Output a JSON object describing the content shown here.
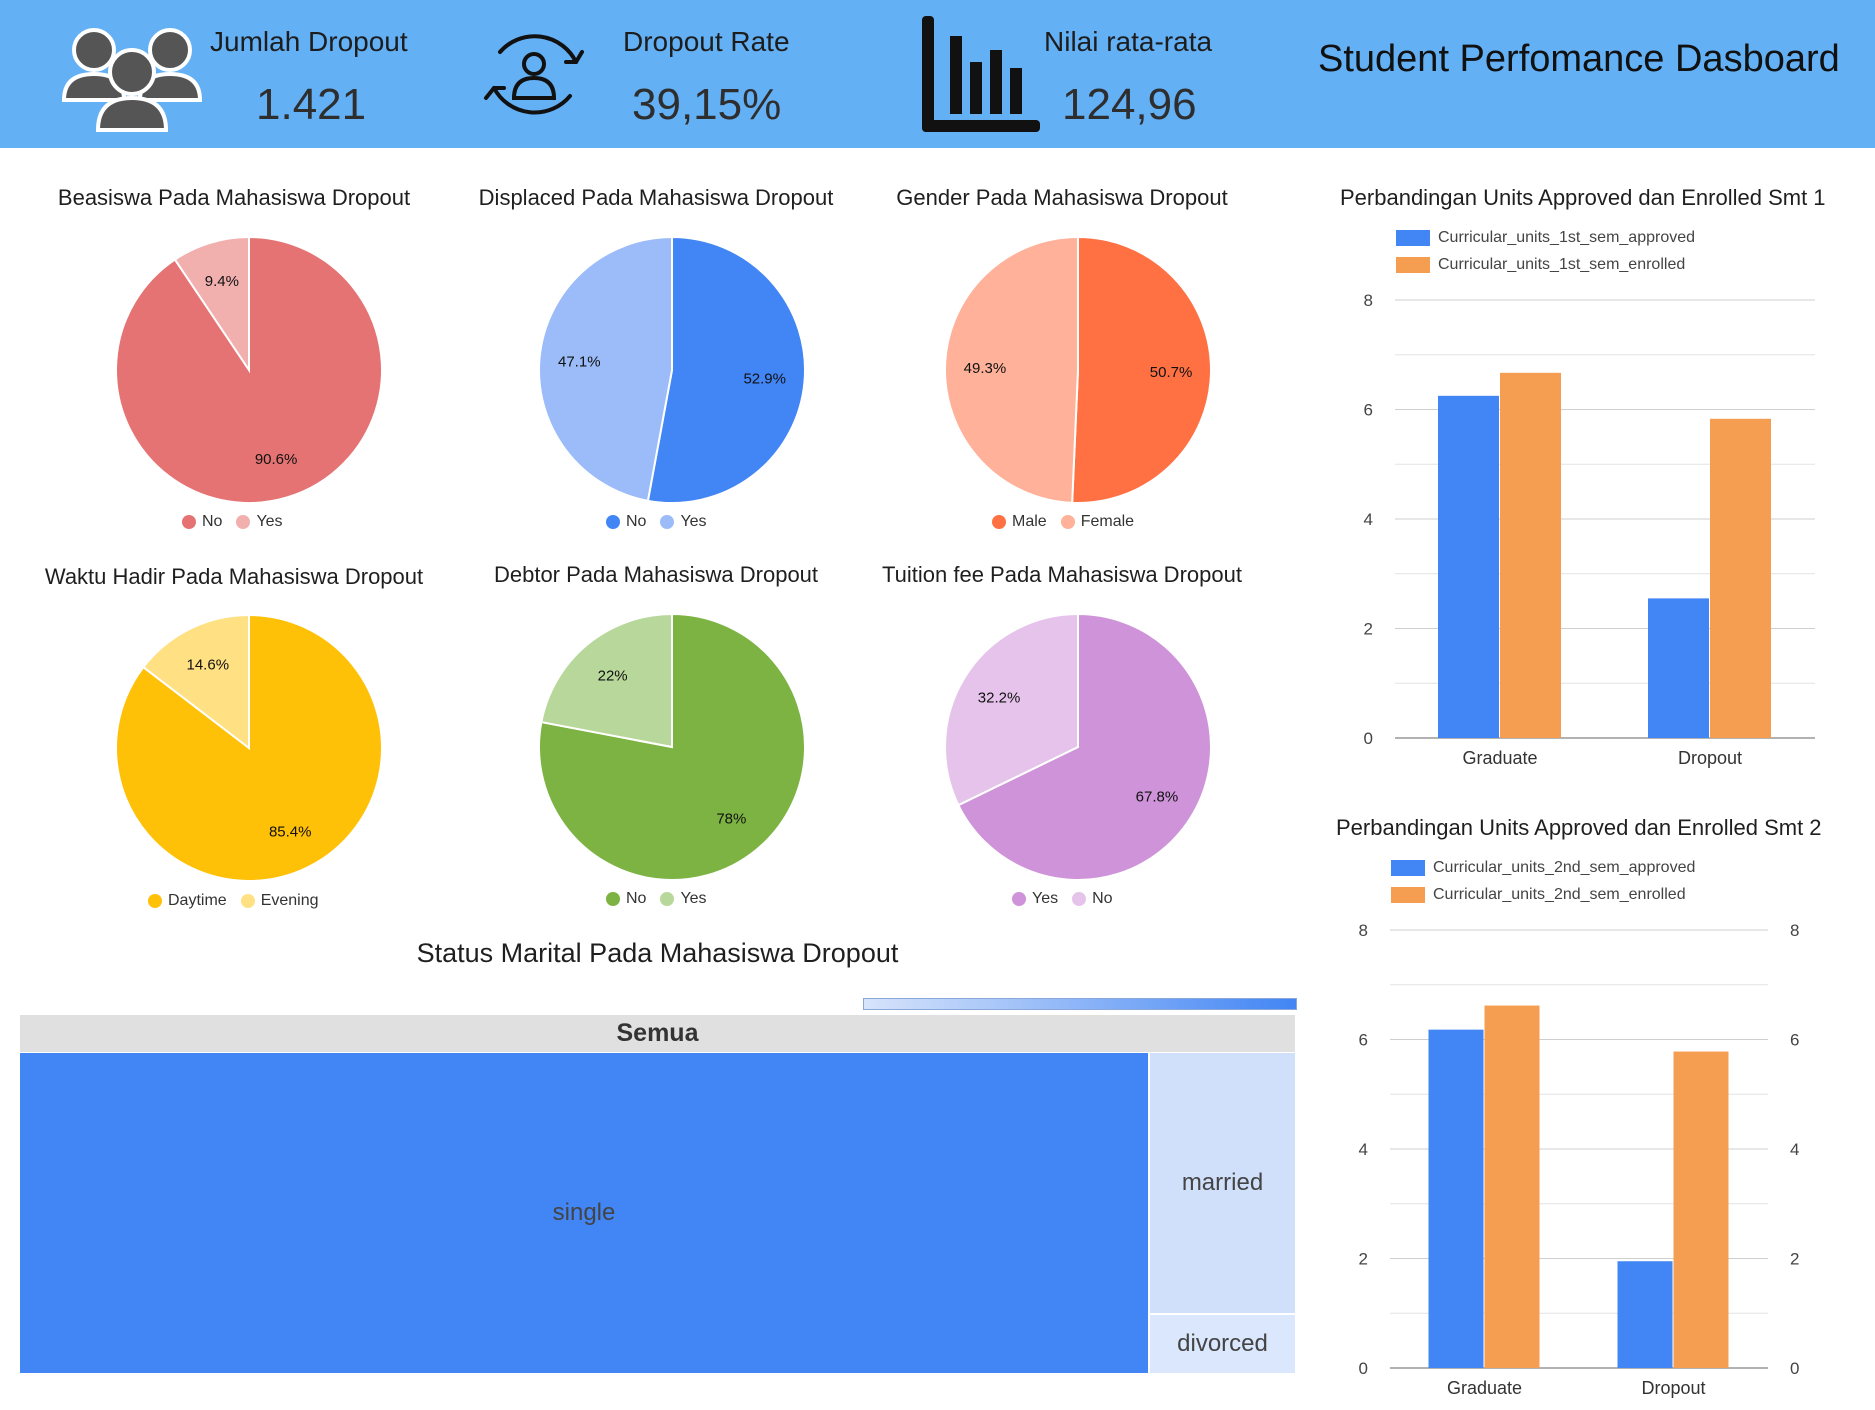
{
  "header": {
    "title": "Student Perfomance Dasboard",
    "kpis": [
      {
        "label": "Jumlah Dropout",
        "value": "1.421",
        "icon": "people-group-icon"
      },
      {
        "label": "Dropout Rate",
        "value": "39,15%",
        "icon": "person-cycle-icon"
      },
      {
        "label": "Nilai rata-rata",
        "value": "124,96",
        "icon": "bar-chart-icon"
      }
    ],
    "colors": {
      "background": "#63b0f5",
      "icon": "#555555"
    }
  },
  "pies": [
    {
      "title": "Beasiswa Pada Mahasiswa Dropout",
      "slices": [
        {
          "label": "No",
          "value": 90.6,
          "text": "90.6%",
          "color": "#e57373"
        },
        {
          "label": "Yes",
          "value": 9.4,
          "text": "9.4%",
          "color": "#f1b0ae"
        }
      ]
    },
    {
      "title": "Displaced Pada Mahasiswa Dropout",
      "slices": [
        {
          "label": "No",
          "value": 52.9,
          "text": "52.9%",
          "color": "#4285f4"
        },
        {
          "label": "Yes",
          "value": 47.1,
          "text": "47.1%",
          "color": "#9bbcf9"
        }
      ]
    },
    {
      "title": "Gender Pada Mahasiswa Dropout",
      "slices": [
        {
          "label": "Male",
          "value": 50.7,
          "text": "50.7%",
          "color": "#ff7043"
        },
        {
          "label": "Female",
          "value": 49.3,
          "text": "49.3%",
          "color": "#ffb199"
        }
      ]
    },
    {
      "title": "Waktu Hadir Pada Mahasiswa Dropout",
      "slices": [
        {
          "label": "Daytime",
          "value": 85.4,
          "text": "85.4%",
          "color": "#ffc107"
        },
        {
          "label": "Evening",
          "value": 14.6,
          "text": "14.6%",
          "color": "#ffe082"
        }
      ]
    },
    {
      "title": "Debtor Pada Mahasiswa Dropout",
      "slices": [
        {
          "label": "No",
          "value": 78,
          "text": "78%",
          "color": "#7cb342"
        },
        {
          "label": "Yes",
          "value": 22,
          "text": "22%",
          "color": "#b8d89b"
        }
      ]
    },
    {
      "title": "Tuition fee Pada Mahasiswa Dropout",
      "slices": [
        {
          "label": "Yes",
          "value": 67.8,
          "text": "67.8%",
          "color": "#ce93d8"
        },
        {
          "label": "No",
          "value": 32.2,
          "text": "32.2%",
          "color": "#e6c3eb"
        }
      ]
    }
  ],
  "chart_data": [
    {
      "type": "bar",
      "title": "Perbandingan Units Approved dan Enrolled Smt 1",
      "categories": [
        "Graduate",
        "Dropout"
      ],
      "series": [
        {
          "name": "Curricular_units_1st_sem_approved",
          "values": [
            6.25,
            2.55
          ],
          "color": "#4285f4"
        },
        {
          "name": "Curricular_units_1st_sem_enrolled",
          "values": [
            6.67,
            5.83
          ],
          "color": "#f59e52"
        }
      ],
      "ylim": [
        0,
        8
      ],
      "yticks": [
        "0",
        "2",
        "4",
        "6",
        "8"
      ],
      "right_axis": false
    },
    {
      "type": "bar",
      "title": "Perbandingan Units Approved dan Enrolled Smt 2",
      "categories": [
        "Graduate",
        "Dropout"
      ],
      "series": [
        {
          "name": "Curricular_units_2nd_sem_approved",
          "values": [
            6.18,
            1.95
          ],
          "color": "#4285f4"
        },
        {
          "name": "Curricular_units_2nd_sem_enrolled",
          "values": [
            6.62,
            5.78
          ],
          "color": "#f59e52"
        }
      ],
      "ylim": [
        0,
        8
      ],
      "yticks": [
        "0",
        "2",
        "4",
        "6",
        "8"
      ],
      "right_axis": true
    },
    {
      "type": "treemap",
      "title": "Status Marital Pada Mahasiswa Dropout",
      "root": "Semua",
      "items": [
        {
          "label": "single"
        },
        {
          "label": "married"
        },
        {
          "label": "divorced"
        }
      ]
    }
  ]
}
